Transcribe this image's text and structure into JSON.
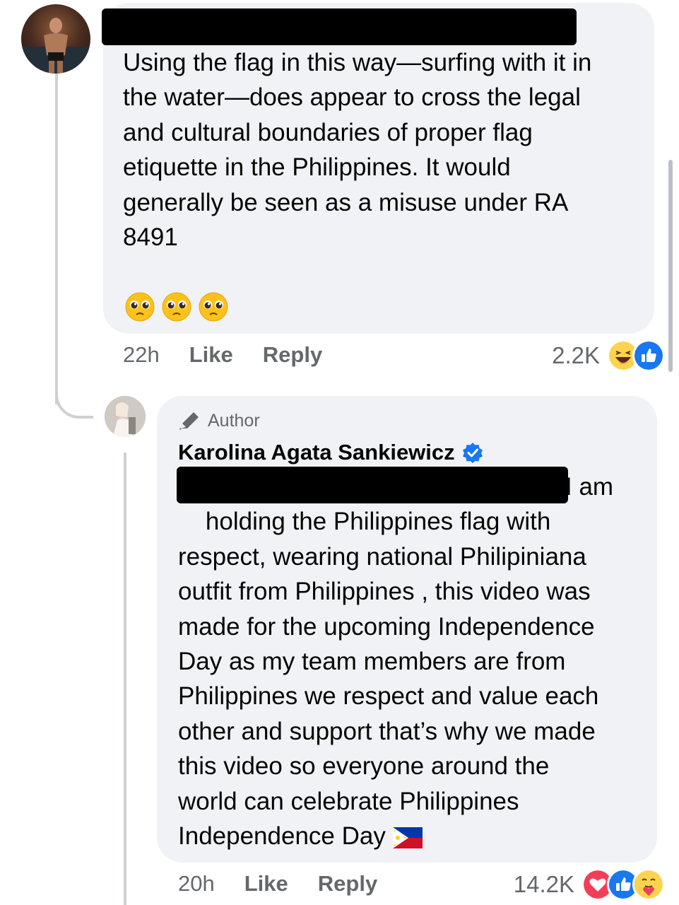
{
  "comment1": {
    "text": "Using the flag in this way—surfing with it in\nthe water—does appear to cross the legal\nand cultural boundaries of proper flag\netiquette in the Philippines. It would\ngenerally be seen as a misuse under RA\n8491",
    "emoji_icons": [
      "pleading-face-icon",
      "pleading-face-icon",
      "pleading-face-icon"
    ],
    "time": "22h",
    "like_label": "Like",
    "reply_label": "Reply",
    "reaction_count": "2.2K",
    "reaction_icons": [
      "haha-icon",
      "like-icon"
    ]
  },
  "comment2": {
    "author_badge": "Author",
    "author_name": "Karolina Agata Sankiewicz",
    "lead_text": "I am",
    "text": "holding the Philippines flag with\nrespect, wearing national Philipiniana\noutfit from Philippines , this video was\nmade for the upcoming Independence\nDay as my team members are from\nPhilippines we respect and value each\nother and support that’s why we made\nthis video so everyone around the\nworld can celebrate Philippines\nIndependence Day",
    "flag_icon": "philippines-flag-icon",
    "time": "20h",
    "like_label": "Like",
    "reply_label": "Reply",
    "reaction_count": "14.2K",
    "reaction_icons": [
      "love-icon",
      "like-icon",
      "care-icon"
    ]
  },
  "colors": {
    "bubble": "#f0f2f5",
    "meta_text": "#65676b",
    "like_blue": "#1877f2",
    "love_red": "#f33e58",
    "haha_yellow": "#fcd34d"
  }
}
